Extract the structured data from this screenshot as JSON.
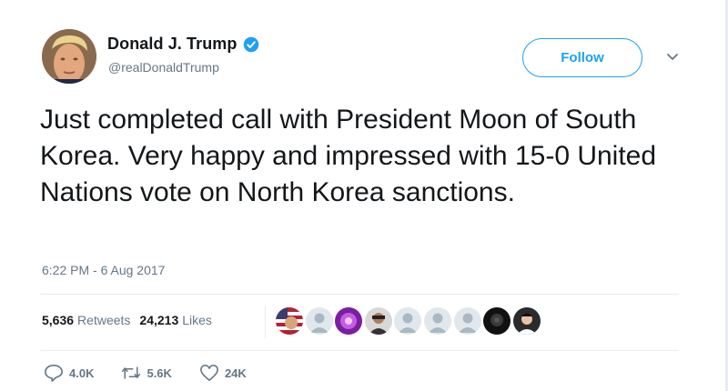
{
  "author": {
    "display_name": "Donald J. Trump",
    "handle": "@realDonaldTrump",
    "verified": true
  },
  "follow_button": {
    "label": "Follow"
  },
  "tweet": {
    "text": "Just completed call with President Moon of South Korea. Very happy and impressed with 15-0 United Nations vote on North Korea sanctions.",
    "timestamp": "6:22 PM - 6 Aug 2017"
  },
  "stats": {
    "retweets_count": "5,636",
    "retweets_label": "Retweets",
    "likes_count": "24,213",
    "likes_label": "Likes"
  },
  "liker_avatars": [
    "flag",
    "default",
    "purple",
    "person",
    "default",
    "default",
    "default",
    "dark",
    "person"
  ],
  "actions": {
    "replies": "4.0K",
    "retweets": "5.6K",
    "likes": "24K"
  },
  "colors": {
    "accent": "#1da1f2",
    "text": "#14171a",
    "secondary": "#657786",
    "divider": "#e6ecf0"
  }
}
